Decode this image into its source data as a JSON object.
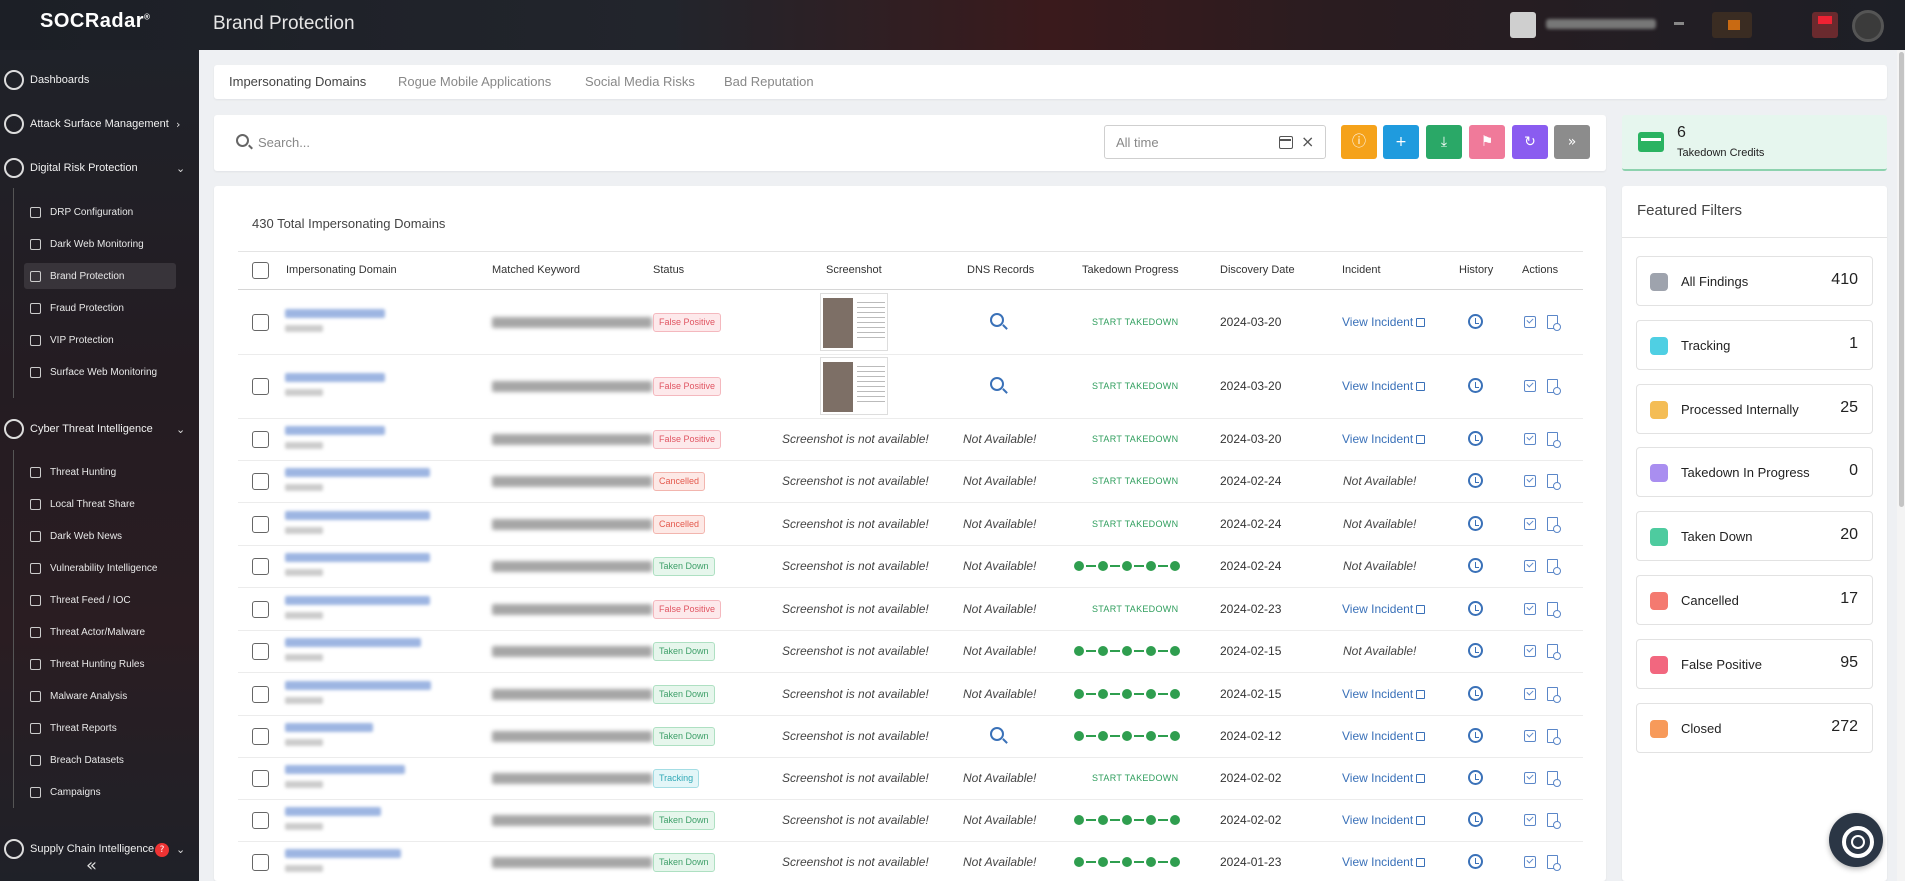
{
  "app": {
    "logo": "SOCRadar",
    "page_title": "Brand Protection"
  },
  "sidebar": {
    "sections": [
      {
        "label": "Dashboards"
      },
      {
        "label": "Attack Surface Management"
      },
      {
        "label": "Digital Risk Protection"
      },
      {
        "label": "Cyber Threat Intelligence"
      },
      {
        "label": "Supply Chain Intelligence"
      }
    ],
    "drp_items": [
      "DRP Configuration",
      "Dark Web Monitoring",
      "Brand Protection",
      "Fraud Protection",
      "VIP Protection",
      "Surface Web Monitoring"
    ],
    "cti_items": [
      "Threat Hunting",
      "Local Threat Share",
      "Dark Web News",
      "Vulnerability Intelligence",
      "Threat Feed / IOC",
      "Threat Actor/Malware",
      "Threat Hunting Rules",
      "Malware Analysis",
      "Threat Reports",
      "Breach Datasets",
      "Campaigns"
    ],
    "help": "?"
  },
  "tabs": [
    "Impersonating Domains",
    "Rogue Mobile Applications",
    "Social Media Risks",
    "Bad Reputation"
  ],
  "search": {
    "placeholder": "Search..."
  },
  "date_filter": {
    "value": "All time"
  },
  "credits": {
    "count": "6",
    "label": "Takedown Credits"
  },
  "table": {
    "total_label": "430 Total Impersonating Domains",
    "headers": [
      "Impersonating Domain",
      "Matched Keyword",
      "Status",
      "Screenshot",
      "DNS Records",
      "Takedown Progress",
      "Discovery Date",
      "Incident",
      "History",
      "Actions"
    ],
    "start_takedown": "START TAKEDOWN",
    "not_available": "Not Available!",
    "screenshot_na": "Screenshot is not available!",
    "view_incident": "View Incident",
    "rows": [
      {
        "status": "False Positive",
        "status_class": "b-fp",
        "shot": true,
        "dns": true,
        "progress": "start",
        "date": "2024-03-20",
        "incident": true
      },
      {
        "status": "False Positive",
        "status_class": "b-fp",
        "shot": true,
        "dns": true,
        "progress": "start",
        "date": "2024-03-20",
        "incident": true
      },
      {
        "status": "False Positive",
        "status_class": "b-fp",
        "shot": false,
        "dns": false,
        "progress": "start",
        "date": "2024-03-20",
        "incident": true
      },
      {
        "status": "Cancelled",
        "status_class": "b-cancel",
        "shot": false,
        "dns": false,
        "progress": "start",
        "date": "2024-02-24",
        "incident": false
      },
      {
        "status": "Cancelled",
        "status_class": "b-cancel",
        "shot": false,
        "dns": false,
        "progress": "start",
        "date": "2024-02-24",
        "incident": false
      },
      {
        "status": "Taken Down",
        "status_class": "b-taken",
        "shot": false,
        "dns": false,
        "progress": "dots",
        "date": "2024-02-24",
        "incident": false
      },
      {
        "status": "False Positive",
        "status_class": "b-fp",
        "shot": false,
        "dns": false,
        "progress": "start",
        "date": "2024-02-23",
        "incident": true
      },
      {
        "status": "Taken Down",
        "status_class": "b-taken",
        "shot": false,
        "dns": false,
        "progress": "dots",
        "date": "2024-02-15",
        "incident": false
      },
      {
        "status": "Taken Down",
        "status_class": "b-taken",
        "shot": false,
        "dns": false,
        "progress": "dots",
        "date": "2024-02-15",
        "incident": true
      },
      {
        "status": "Taken Down",
        "status_class": "b-taken",
        "shot": false,
        "dns": true,
        "progress": "dots",
        "date": "2024-02-12",
        "incident": true
      },
      {
        "status": "Tracking",
        "status_class": "b-track",
        "shot": false,
        "dns": false,
        "progress": "start",
        "date": "2024-02-02",
        "incident": true
      },
      {
        "status": "Taken Down",
        "status_class": "b-taken",
        "shot": false,
        "dns": false,
        "progress": "dots",
        "date": "2024-02-02",
        "incident": true
      },
      {
        "status": "Taken Down",
        "status_class": "b-taken",
        "shot": false,
        "dns": false,
        "progress": "dots",
        "date": "2024-01-23",
        "incident": true
      }
    ]
  },
  "featured_filters": {
    "title": "Featured Filters",
    "items": [
      {
        "label": "All Findings",
        "count": "410",
        "color": "#9ea3ad"
      },
      {
        "label": "Tracking",
        "count": "1",
        "color": "#4fcfe3"
      },
      {
        "label": "Processed Internally",
        "count": "25",
        "color": "#f4bd56"
      },
      {
        "label": "Takedown In Progress",
        "count": "0",
        "color": "#a98ef0"
      },
      {
        "label": "Taken Down",
        "count": "20",
        "color": "#4ecb9f"
      },
      {
        "label": "Cancelled",
        "count": "17",
        "color": "#f47a70"
      },
      {
        "label": "False Positive",
        "count": "95",
        "color": "#f2677f"
      },
      {
        "label": "Closed",
        "count": "272",
        "color": "#f79a5a"
      }
    ]
  },
  "colors": {
    "accent_blue": "#3970b8",
    "green": "#2f9e4f"
  }
}
